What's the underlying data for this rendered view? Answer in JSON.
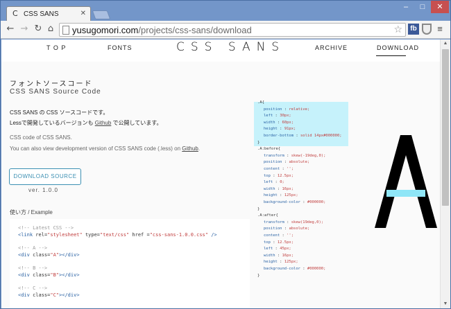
{
  "browser": {
    "tab_title": "CSS SANS",
    "tab_favicon": "C",
    "tab_close": "✕",
    "url_host": "yusugomori.com",
    "url_path": "/projects/css-sans/download",
    "ext_fb": "fb",
    "controls": {
      "minimize": "–",
      "maximize": "□",
      "close": "✕"
    }
  },
  "nav": {
    "top": "T O P",
    "fonts": "FONTS",
    "logo": "CSS SANS",
    "archive": "ARCHIVE",
    "download": "DOWNLOAD"
  },
  "heading": {
    "jp": "フォントソースコード",
    "en": "CSS SANS Source Code"
  },
  "intro": {
    "jp_line1": "CSS SANS の CSS ソースコードです。",
    "jp_line2_pre": "Lessで開発しているバージョンも ",
    "jp_line2_link": "Github",
    "jp_line2_post": " で公開しています。",
    "en_line1": "CSS code of CSS SANS.",
    "en_line2_pre": "You can also view development version of CSS SANS code (.less) on ",
    "en_line2_link": "Github",
    "en_line2_post": "."
  },
  "download": {
    "button": "DOWNLOAD SOURCE",
    "version": "ver. 1.0.0"
  },
  "example": {
    "label": "使い方 / Example",
    "lines": [
      {
        "comment": "<!-- Latest CSS -->"
      },
      {
        "tag_open": "<link ",
        "attr1": "rel=",
        "val1": "\"stylesheet\"",
        "attr2": " type=",
        "val2": "\"text/css\"",
        "attr3": " href =",
        "val3": "\"css-sans-1.0.0.css\"",
        "tag_close": " />"
      },
      {
        "comment": "<!-- A -->"
      },
      {
        "tag_open": "<div ",
        "attr1": "class=",
        "val1": "\"A\"",
        "tag_close": "></div>"
      },
      {
        "comment": "<!-- B -->"
      },
      {
        "tag_open": "<div ",
        "attr1": "class=",
        "val1": "\"B\"",
        "tag_close": "></div>"
      },
      {
        "comment": "<!-- C -->"
      },
      {
        "tag_open": "<div ",
        "attr1": "class=",
        "val1": "\"C\"",
        "tag_close": "></div>"
      }
    ]
  },
  "css_code": {
    "a_selector": ".A{",
    "a_props": [
      {
        "p": "position",
        "v": "relative;"
      },
      {
        "p": "left",
        "v": "30px;"
      },
      {
        "p": "width",
        "v": "60px;"
      },
      {
        "p": "height",
        "v": "91px;"
      },
      {
        "p": "border-bottom",
        "v": "solid 14px#000000;"
      }
    ],
    "a_close": "}",
    "before_selector": ".A:before{",
    "before_props": [
      {
        "p": "transform",
        "v": "skew(-19deg,0);"
      },
      {
        "p": "position",
        "v": "absolute;"
      },
      {
        "p": "content",
        "v": "'';"
      },
      {
        "p": "top",
        "v": "12.5px;"
      },
      {
        "p": "left",
        "v": "0;"
      },
      {
        "p": "width",
        "v": "16px;"
      },
      {
        "p": "height",
        "v": "125px;"
      },
      {
        "p": "background-color",
        "v": "#000000;"
      }
    ],
    "before_close": "}",
    "after_selector": ".A:after{",
    "after_props": [
      {
        "p": "transform",
        "v": "skew(19deg,0);"
      },
      {
        "p": "position",
        "v": "absolute;"
      },
      {
        "p": "content",
        "v": "'';"
      },
      {
        "p": "top",
        "v": "12.5px;"
      },
      {
        "p": "left",
        "v": "45px;"
      },
      {
        "p": "width",
        "v": "16px;"
      },
      {
        "p": "height",
        "v": "125px;"
      },
      {
        "p": "background-color",
        "v": "#000000;"
      }
    ],
    "after_close": "}"
  },
  "colors": {
    "accent": "#3b8fb2",
    "highlight": "#c6f2fb",
    "glyph_highlight": "#8fe6f7"
  }
}
